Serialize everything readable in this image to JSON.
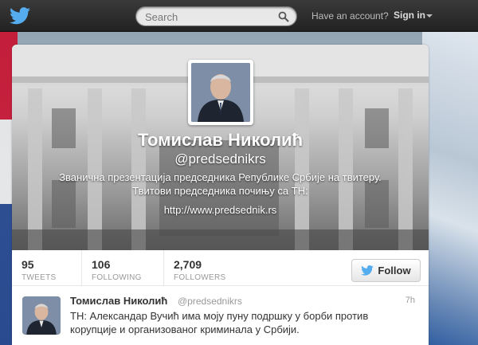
{
  "topbar": {
    "search_placeholder": "Search",
    "have_account": "Have an account?",
    "sign_in": "Sign in"
  },
  "profile": {
    "name": "Томислав Николић",
    "handle": "@predsednikrs",
    "bio": "Званична презентација председника Републике Србије на твитеру. Твитови председника почињу са ТН:",
    "url": "http://www.predsednik.rs"
  },
  "stats": {
    "tweets": {
      "value": "95",
      "label": "TWEETS"
    },
    "following": {
      "value": "106",
      "label": "FOLLOWING"
    },
    "followers": {
      "value": "2,709",
      "label": "FOLLOWERS"
    }
  },
  "follow_button": {
    "label": "Follow"
  },
  "tweet": {
    "name": "Томислав Николић",
    "handle": "@predsednikrs",
    "time": "7h",
    "text": "ТН: Александар Вучић има моју пуну подршку у борби против корупције и организованог криминала у Србији."
  },
  "colors": {
    "twitter_blue": "#55acee",
    "topbar": "#2a2a2a"
  },
  "icons": [
    "twitter-bird-icon",
    "search-icon",
    "caret-down-icon",
    "twitter-bird-small-icon"
  ]
}
